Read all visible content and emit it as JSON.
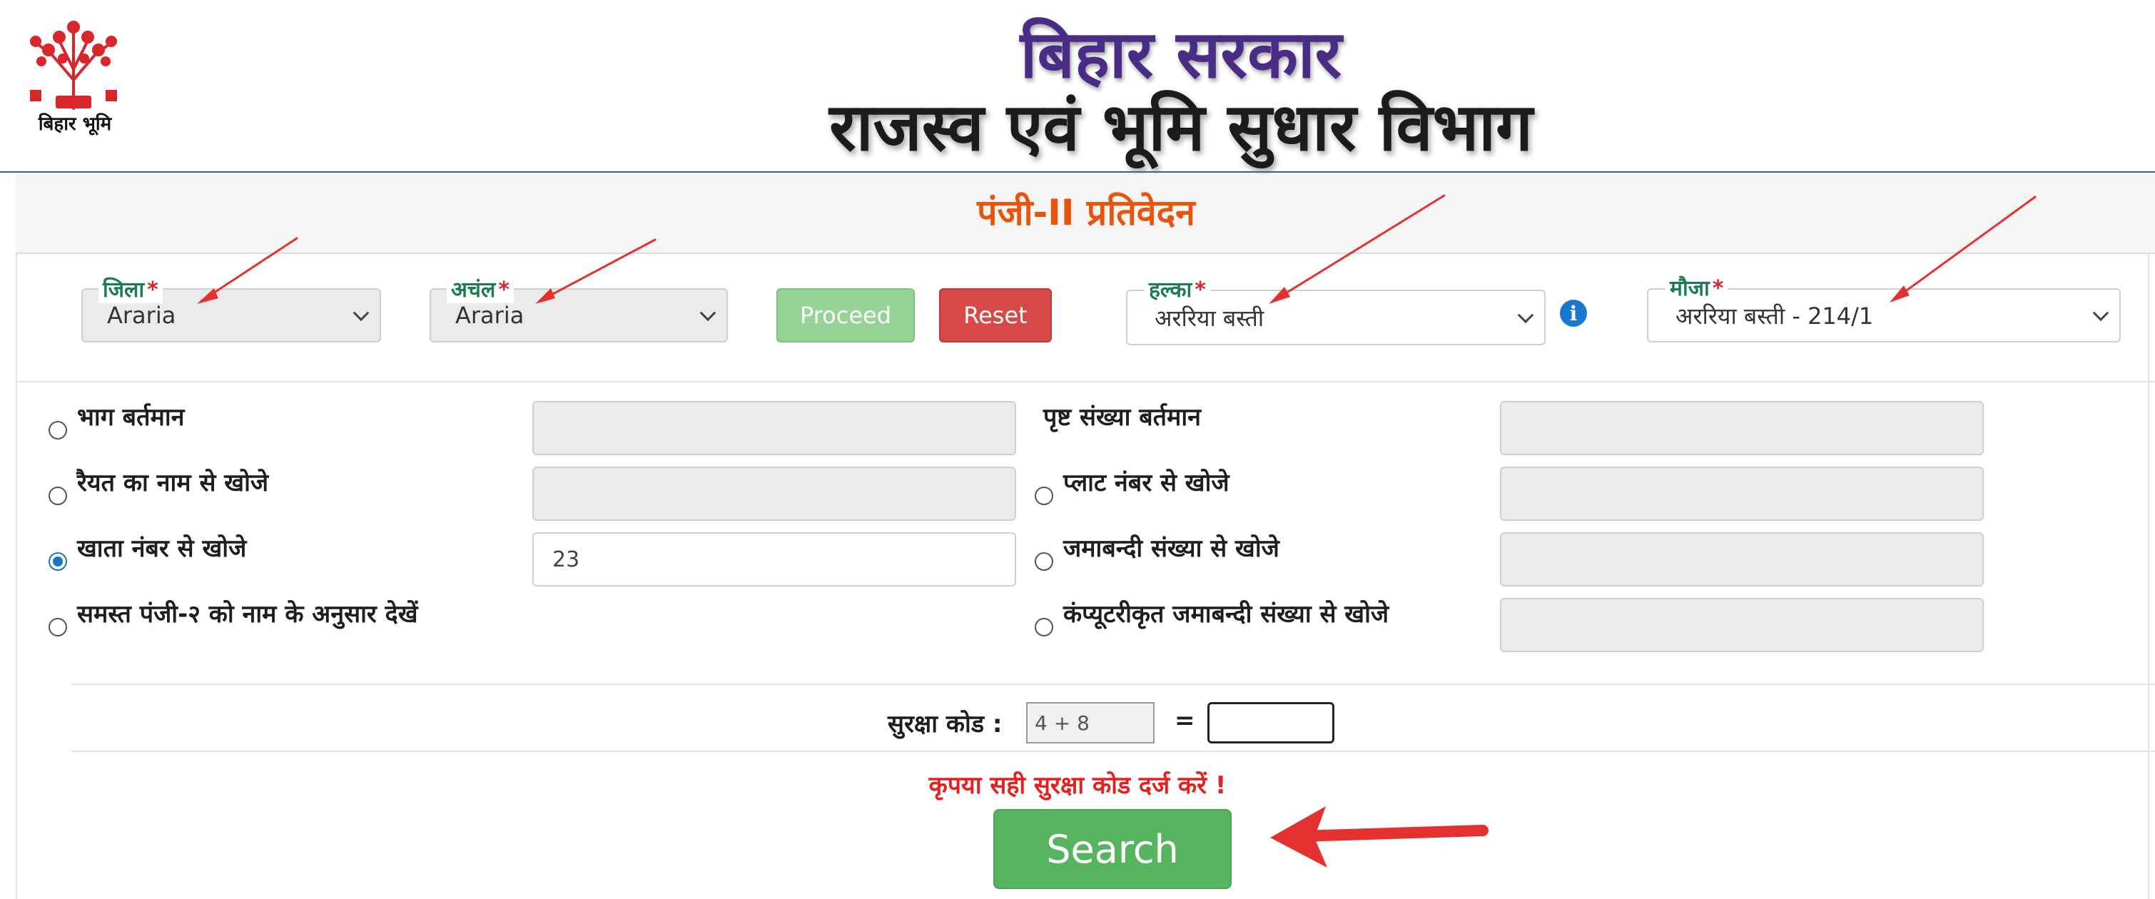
{
  "header": {
    "logo_text": "बिहार भूमि",
    "title_line1": "बिहार सरकार",
    "title_line2": "राजस्व एवं भूमि सुधार विभाग"
  },
  "panel": {
    "title": "पंजी-II प्रतिवेदन"
  },
  "filters": {
    "district": {
      "label": "जिला",
      "required": "*",
      "value": "Araria"
    },
    "circle": {
      "label": "अचंल",
      "required": "*",
      "value": "Araria"
    },
    "proceed_label": "Proceed",
    "reset_label": "Reset",
    "halka": {
      "label": "हल्का",
      "required": "*",
      "value": "अररिया बस्ती"
    },
    "info_glyph": "i",
    "mauza": {
      "label": "मौजा",
      "required": "*",
      "value": "अररिया बस्ती - 214/1"
    }
  },
  "search_options": {
    "left": [
      {
        "label": "भाग बर्तमान",
        "value": "",
        "selected": false
      },
      {
        "label": "रैयत का नाम से खोजे",
        "value": "",
        "selected": false
      },
      {
        "label": "खाता नंबर से खोजे",
        "value": "23",
        "selected": true
      },
      {
        "label": "समस्त पंजी-२ को नाम के अनुसार देखें",
        "selected": false
      }
    ],
    "right": [
      {
        "label": "पृष्ट संख्या बर्तमान",
        "value": ""
      },
      {
        "label": "प्लाट नंबर से खोजे",
        "value": "",
        "selected": false
      },
      {
        "label": "जमाबन्दी संख्या से खोजे",
        "value": "",
        "selected": false
      },
      {
        "label": "कंप्यूटरीकृत जमाबन्दी संख्या से खोजे",
        "value": "",
        "selected": false
      }
    ]
  },
  "captcha": {
    "label": "सुरक्षा कोड :",
    "question": "4 + 8",
    "equals": "=",
    "answer": ""
  },
  "error_message": "कृपया सही सुरक्षा कोड दर्ज करें !",
  "search_label": "Search",
  "colors": {
    "title_purple": "#4a2b86",
    "panel_title_orange": "#e8540c",
    "label_green": "#1c7b55",
    "required_red": "#d8262a",
    "proceed_green": "#96d396",
    "reset_red": "#d84848",
    "search_green": "#57b45e",
    "error_red": "#e52020",
    "annotation_arrow_red": "#e53030",
    "radio_blue": "#1a73c8"
  }
}
